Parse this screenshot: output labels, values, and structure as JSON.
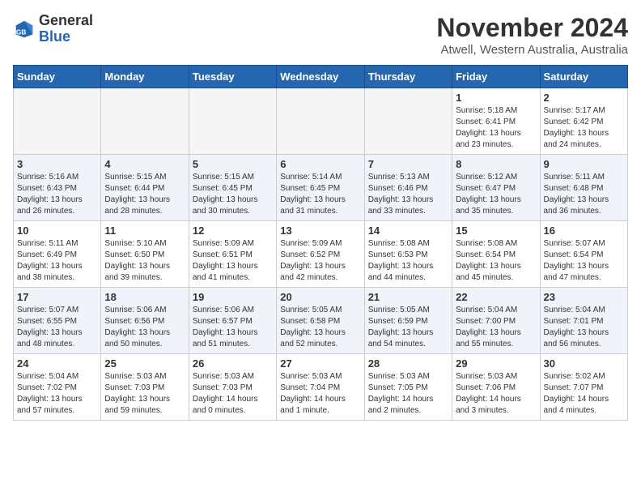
{
  "header": {
    "logo_general": "General",
    "logo_blue": "Blue",
    "month_year": "November 2024",
    "location": "Atwell, Western Australia, Australia"
  },
  "days_of_week": [
    "Sunday",
    "Monday",
    "Tuesday",
    "Wednesday",
    "Thursday",
    "Friday",
    "Saturday"
  ],
  "weeks": [
    [
      {
        "day": "",
        "info": ""
      },
      {
        "day": "",
        "info": ""
      },
      {
        "day": "",
        "info": ""
      },
      {
        "day": "",
        "info": ""
      },
      {
        "day": "",
        "info": ""
      },
      {
        "day": "1",
        "info": "Sunrise: 5:18 AM\nSunset: 6:41 PM\nDaylight: 13 hours\nand 23 minutes."
      },
      {
        "day": "2",
        "info": "Sunrise: 5:17 AM\nSunset: 6:42 PM\nDaylight: 13 hours\nand 24 minutes."
      }
    ],
    [
      {
        "day": "3",
        "info": "Sunrise: 5:16 AM\nSunset: 6:43 PM\nDaylight: 13 hours\nand 26 minutes."
      },
      {
        "day": "4",
        "info": "Sunrise: 5:15 AM\nSunset: 6:44 PM\nDaylight: 13 hours\nand 28 minutes."
      },
      {
        "day": "5",
        "info": "Sunrise: 5:15 AM\nSunset: 6:45 PM\nDaylight: 13 hours\nand 30 minutes."
      },
      {
        "day": "6",
        "info": "Sunrise: 5:14 AM\nSunset: 6:45 PM\nDaylight: 13 hours\nand 31 minutes."
      },
      {
        "day": "7",
        "info": "Sunrise: 5:13 AM\nSunset: 6:46 PM\nDaylight: 13 hours\nand 33 minutes."
      },
      {
        "day": "8",
        "info": "Sunrise: 5:12 AM\nSunset: 6:47 PM\nDaylight: 13 hours\nand 35 minutes."
      },
      {
        "day": "9",
        "info": "Sunrise: 5:11 AM\nSunset: 6:48 PM\nDaylight: 13 hours\nand 36 minutes."
      }
    ],
    [
      {
        "day": "10",
        "info": "Sunrise: 5:11 AM\nSunset: 6:49 PM\nDaylight: 13 hours\nand 38 minutes."
      },
      {
        "day": "11",
        "info": "Sunrise: 5:10 AM\nSunset: 6:50 PM\nDaylight: 13 hours\nand 39 minutes."
      },
      {
        "day": "12",
        "info": "Sunrise: 5:09 AM\nSunset: 6:51 PM\nDaylight: 13 hours\nand 41 minutes."
      },
      {
        "day": "13",
        "info": "Sunrise: 5:09 AM\nSunset: 6:52 PM\nDaylight: 13 hours\nand 42 minutes."
      },
      {
        "day": "14",
        "info": "Sunrise: 5:08 AM\nSunset: 6:53 PM\nDaylight: 13 hours\nand 44 minutes."
      },
      {
        "day": "15",
        "info": "Sunrise: 5:08 AM\nSunset: 6:54 PM\nDaylight: 13 hours\nand 45 minutes."
      },
      {
        "day": "16",
        "info": "Sunrise: 5:07 AM\nSunset: 6:54 PM\nDaylight: 13 hours\nand 47 minutes."
      }
    ],
    [
      {
        "day": "17",
        "info": "Sunrise: 5:07 AM\nSunset: 6:55 PM\nDaylight: 13 hours\nand 48 minutes."
      },
      {
        "day": "18",
        "info": "Sunrise: 5:06 AM\nSunset: 6:56 PM\nDaylight: 13 hours\nand 50 minutes."
      },
      {
        "day": "19",
        "info": "Sunrise: 5:06 AM\nSunset: 6:57 PM\nDaylight: 13 hours\nand 51 minutes."
      },
      {
        "day": "20",
        "info": "Sunrise: 5:05 AM\nSunset: 6:58 PM\nDaylight: 13 hours\nand 52 minutes."
      },
      {
        "day": "21",
        "info": "Sunrise: 5:05 AM\nSunset: 6:59 PM\nDaylight: 13 hours\nand 54 minutes."
      },
      {
        "day": "22",
        "info": "Sunrise: 5:04 AM\nSunset: 7:00 PM\nDaylight: 13 hours\nand 55 minutes."
      },
      {
        "day": "23",
        "info": "Sunrise: 5:04 AM\nSunset: 7:01 PM\nDaylight: 13 hours\nand 56 minutes."
      }
    ],
    [
      {
        "day": "24",
        "info": "Sunrise: 5:04 AM\nSunset: 7:02 PM\nDaylight: 13 hours\nand 57 minutes."
      },
      {
        "day": "25",
        "info": "Sunrise: 5:03 AM\nSunset: 7:03 PM\nDaylight: 13 hours\nand 59 minutes."
      },
      {
        "day": "26",
        "info": "Sunrise: 5:03 AM\nSunset: 7:03 PM\nDaylight: 14 hours\nand 0 minutes."
      },
      {
        "day": "27",
        "info": "Sunrise: 5:03 AM\nSunset: 7:04 PM\nDaylight: 14 hours\nand 1 minute."
      },
      {
        "day": "28",
        "info": "Sunrise: 5:03 AM\nSunset: 7:05 PM\nDaylight: 14 hours\nand 2 minutes."
      },
      {
        "day": "29",
        "info": "Sunrise: 5:03 AM\nSunset: 7:06 PM\nDaylight: 14 hours\nand 3 minutes."
      },
      {
        "day": "30",
        "info": "Sunrise: 5:02 AM\nSunset: 7:07 PM\nDaylight: 14 hours\nand 4 minutes."
      }
    ]
  ]
}
